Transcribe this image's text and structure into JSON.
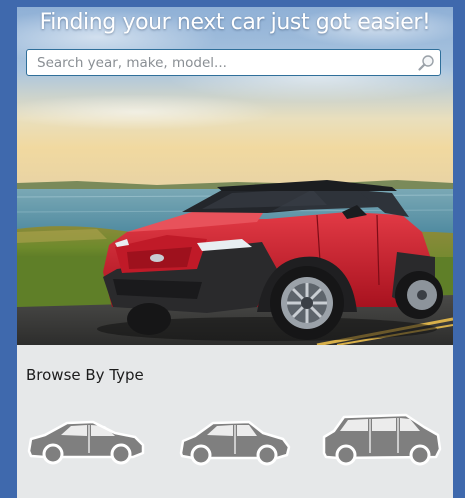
{
  "hero": {
    "headline": "Finding your next car just got easier!"
  },
  "search": {
    "placeholder": "Search year, make, model...",
    "value": ""
  },
  "browse": {
    "title": "Browse By Type",
    "types": [
      {
        "icon": "sedan-icon"
      },
      {
        "icon": "hatchback-icon"
      },
      {
        "icon": "suv-icon"
      }
    ]
  },
  "colors": {
    "frame_blue": "#3f69ad",
    "panel_gray": "#e6e8e9",
    "car_red": "#d2212f",
    "icon_gray": "#7f7f7f"
  }
}
